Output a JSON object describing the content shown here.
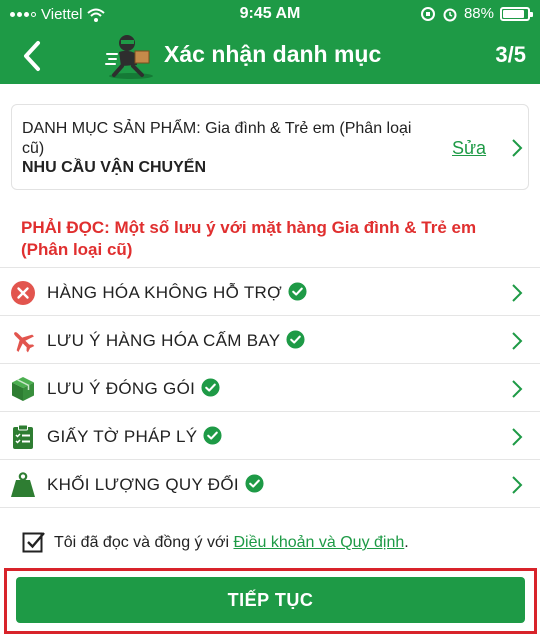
{
  "status_bar": {
    "carrier": "Viettel",
    "time": "9:45 AM",
    "battery": "88%",
    "battery_level": 0.88
  },
  "header": {
    "title": "Xác nhận danh mục",
    "step": "3/5",
    "back_icon": "chevron-left-icon",
    "logo_icon": "courier-icon"
  },
  "category": {
    "label": "DANH MỤC SẢN PHẨM:  Gia đình & Trẻ em (Phân loại cũ)",
    "need": "NHU CẦU VẬN CHUYỂN",
    "edit_label": "Sửa"
  },
  "warning": "PHẢI ĐỌC: Một số lưu ý với mặt hàng  Gia đình & Trẻ em (Phân loại cũ)",
  "items": [
    {
      "label": "HÀNG HÓA KHÔNG HỖ TRỢ",
      "icon": "prohibited-icon",
      "checked": true
    },
    {
      "label": "LƯU Ý HÀNG HÓA CẤM BAY",
      "icon": "airplane-icon",
      "checked": true
    },
    {
      "label": "LƯU Ý ĐÓNG GÓI",
      "icon": "package-icon",
      "checked": true
    },
    {
      "label": "GIẤY TỜ PHÁP LÝ",
      "icon": "clipboard-icon",
      "checked": true
    },
    {
      "label": "KHỐI LƯỢNG QUY ĐỔI",
      "icon": "weight-icon",
      "checked": true
    }
  ],
  "agreement": {
    "text": "Tôi đã đọc và đồng ý với ",
    "link": "Điều khoản và Quy định",
    "suffix": ".",
    "checked": true
  },
  "continue_label": "TIẾP TỤC",
  "colors": {
    "brand_green": "#1e9a46",
    "warning_red": "#e02f2f",
    "highlight_red": "#d8232a"
  }
}
